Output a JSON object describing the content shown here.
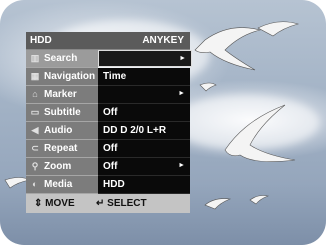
{
  "colors": {
    "header_bg": "#5b5b5b",
    "label_bg": "#7c7c7c",
    "value_bg": "#0a0a0a",
    "footer_bg": "#c4c4c4",
    "sky": "#a3b3c6"
  },
  "menu": {
    "source": "HDD",
    "key_hint": "ANYKEY",
    "items": [
      {
        "label": "Search",
        "icon": "search-icon",
        "value": "",
        "arrow": "►",
        "selected": true
      },
      {
        "label": "Navigation",
        "icon": "navigation-icon",
        "value": "Time",
        "arrow": ""
      },
      {
        "label": "Marker",
        "icon": "marker-icon",
        "value": "",
        "arrow": "►"
      },
      {
        "label": "Subtitle",
        "icon": "subtitle-icon",
        "value": "Off",
        "arrow": ""
      },
      {
        "label": "Audio",
        "icon": "audio-icon",
        "value": "DD D 2/0 L+R",
        "arrow": ""
      },
      {
        "label": "Repeat",
        "icon": "repeat-icon",
        "value": "Off",
        "arrow": ""
      },
      {
        "label": "Zoom",
        "icon": "zoom-icon",
        "value": "Off",
        "arrow": "►"
      },
      {
        "label": "Media",
        "icon": "media-icon",
        "value": "HDD",
        "arrow": ""
      }
    ],
    "footer": {
      "move_label": "MOVE",
      "move_icon": "updown-arrows-icon",
      "select_label": "SELECT",
      "select_icon": "enter-icon"
    }
  }
}
